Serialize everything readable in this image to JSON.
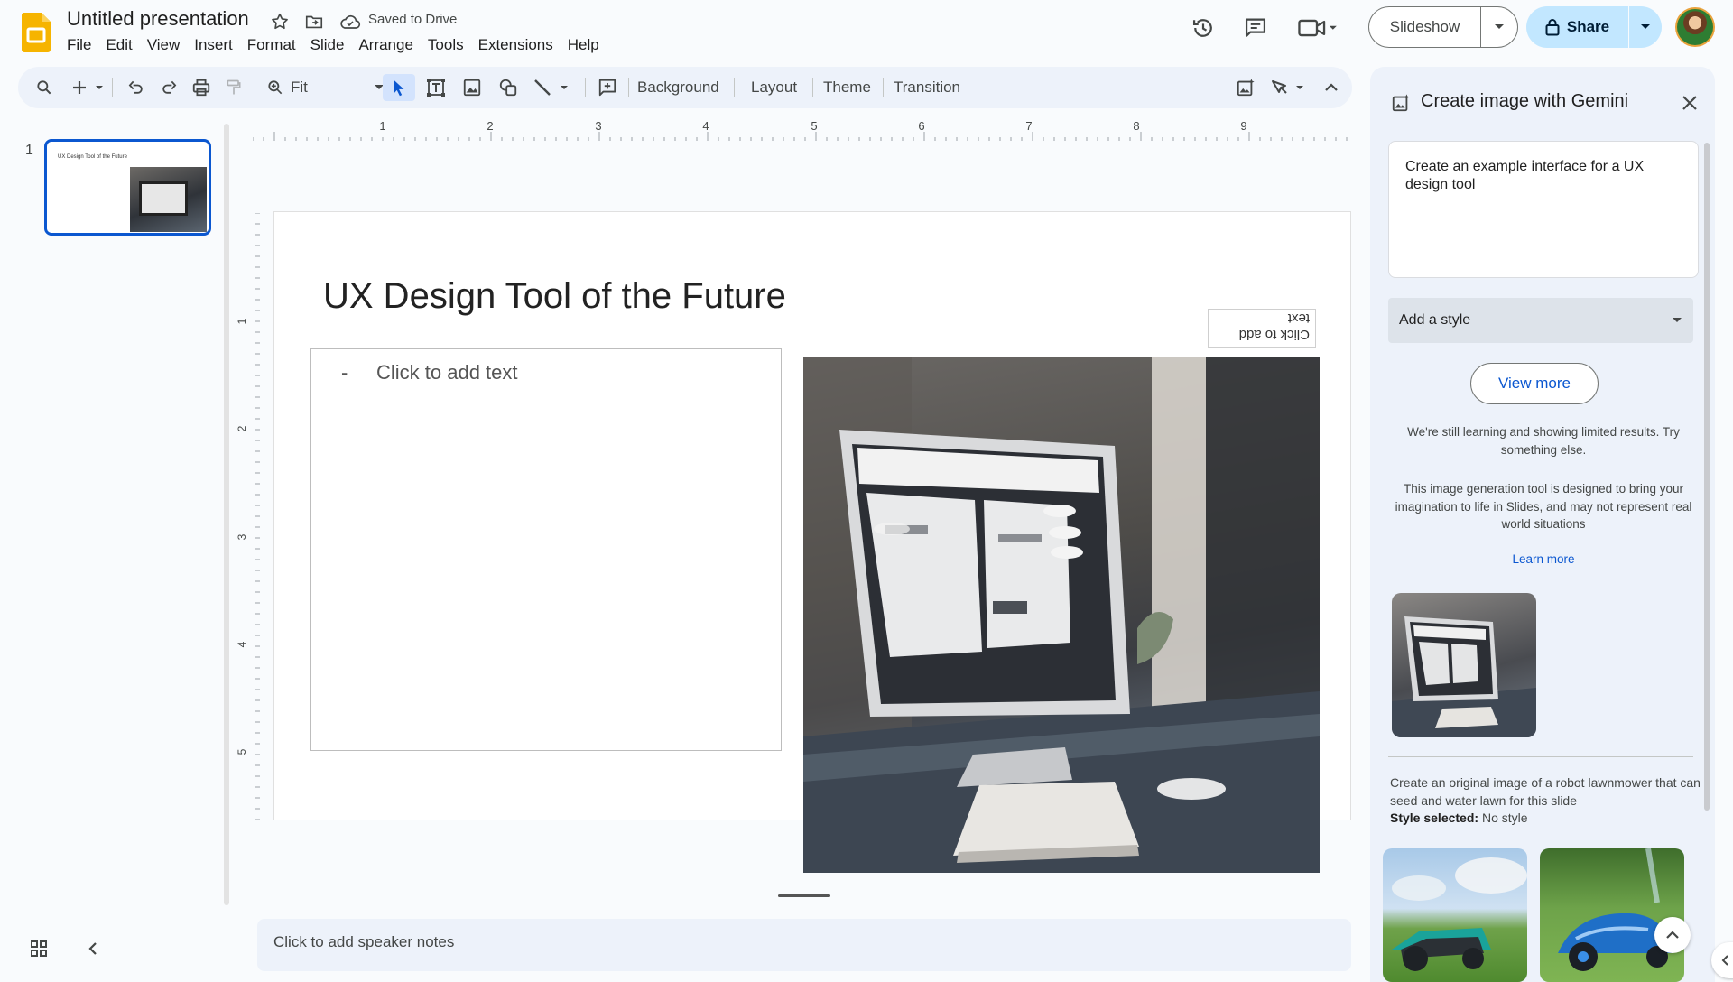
{
  "header": {
    "title": "Untitled presentation",
    "save_status": "Saved to Drive",
    "menu": [
      "File",
      "Edit",
      "View",
      "Insert",
      "Format",
      "Slide",
      "Arrange",
      "Tools",
      "Extensions",
      "Help"
    ],
    "slideshow_label": "Slideshow",
    "share_label": "Share"
  },
  "toolbar": {
    "zoom": "Fit",
    "background_label": "Background",
    "layout_label": "Layout",
    "theme_label": "Theme",
    "transition_label": "Transition"
  },
  "filmstrip": {
    "slide_number": "1",
    "thumb_title": "UX Design Tool of the Future"
  },
  "ruler": {
    "h_ticks": [
      "1",
      "2",
      "3",
      "4",
      "5",
      "6",
      "7",
      "8",
      "9"
    ],
    "v_ticks": [
      "1",
      "2",
      "3",
      "4",
      "5"
    ]
  },
  "slide": {
    "title": "UX Design Tool of the Future",
    "bullet": "-",
    "body_placeholder": "Click to add text",
    "mirrored_placeholder": "Click to add text"
  },
  "speaker_notes": {
    "placeholder": "Click to add speaker notes"
  },
  "panel": {
    "title": "Create image with Gemini",
    "prompt": "Create an example interface for a UX design tool",
    "style_placeholder": "Add a style",
    "view_more_label": "View more",
    "note_1": "We're still learning and showing limited results. Try something else.",
    "note_2": "This image generation tool is designed to bring your imagination to life in Slides, and may not represent real world situations",
    "learn_more": "Learn more",
    "previous_prompt": "Create an original image of a robot lawnmower that can seed and water lawn for this slide",
    "style_selected_label": "Style selected:",
    "style_selected_value": "No style"
  },
  "colors": {
    "accent": "#0b57d0",
    "share_bg": "#c2e7ff",
    "toolbar_bg": "#edf2fa",
    "logo": "#f6b400"
  }
}
